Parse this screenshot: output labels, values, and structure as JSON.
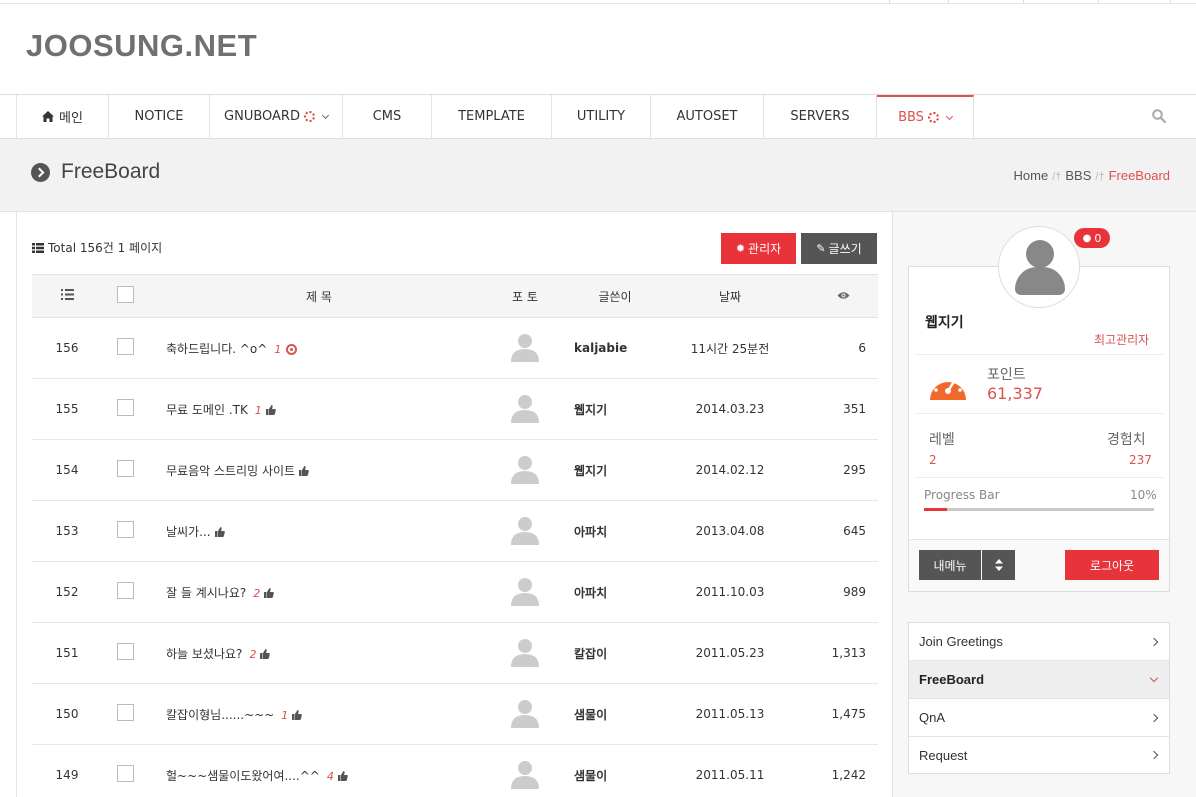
{
  "site": {
    "logo": "JOOSUNG.NET"
  },
  "nav": {
    "items": [
      {
        "label": "메인",
        "icon": "home-icon"
      },
      {
        "label": "NOTICE"
      },
      {
        "label": "GNUBOARD",
        "spinner": true,
        "dropdown": true
      },
      {
        "label": "CMS"
      },
      {
        "label": "TEMPLATE"
      },
      {
        "label": "UTILITY"
      },
      {
        "label": "AUTOSET"
      },
      {
        "label": "SERVERS"
      },
      {
        "label": "BBS",
        "spinner": true,
        "dropdown": true,
        "active": true
      }
    ],
    "search_icon": "search-icon"
  },
  "page": {
    "title": "FreeBoard",
    "breadcrumb": [
      "Home",
      "BBS",
      "FreeBoard"
    ]
  },
  "board": {
    "total_text": "Total 156건 1 페이지",
    "admin_label": "관리자",
    "write_label": "글쓰기",
    "headers": {
      "subject": "제 목",
      "photo": "포 토",
      "writer": "글쓴이",
      "date": "날짜"
    },
    "rows": [
      {
        "num": "156",
        "subject": "축하드립니다. ^o^",
        "comments": "1",
        "badge": "hot",
        "writer": "kaljabie",
        "date": "11시간 25분전",
        "views": "6"
      },
      {
        "num": "155",
        "subject": "무료 도메인 .TK",
        "comments": "1",
        "badge": "thumb",
        "writer": "웹지기",
        "date": "2014.03.23",
        "views": "351"
      },
      {
        "num": "154",
        "subject": "무료음악 스트리밍 사이트",
        "comments": "",
        "badge": "thumb",
        "writer": "웹지기",
        "date": "2014.02.12",
        "views": "295"
      },
      {
        "num": "153",
        "subject": "날씨가...",
        "comments": "",
        "badge": "thumb",
        "writer": "아파치",
        "date": "2013.04.08",
        "views": "645"
      },
      {
        "num": "152",
        "subject": "잘 들 계시나요?",
        "comments": "2",
        "badge": "thumb",
        "writer": "아파치",
        "date": "2011.10.03",
        "views": "989"
      },
      {
        "num": "151",
        "subject": "하늘 보셨나요?",
        "comments": "2",
        "badge": "thumb",
        "writer": "칼잡이",
        "date": "2011.05.23",
        "views": "1,313"
      },
      {
        "num": "150",
        "subject": "칼잡이형님......~~~",
        "comments": "1",
        "badge": "thumb",
        "writer": "샘물이",
        "date": "2011.05.13",
        "views": "1,475"
      },
      {
        "num": "149",
        "subject": "헐~~~샘물이도왔어여....^^",
        "comments": "4",
        "badge": "thumb",
        "writer": "샘물이",
        "date": "2011.05.11",
        "views": "1,242"
      }
    ]
  },
  "profile": {
    "messages": "0",
    "name": "웹지기",
    "role": "최고관리자",
    "point_label": "포인트",
    "point_value": "61,337",
    "level_label": "레벨",
    "level_value": "2",
    "exp_label": "경험치",
    "exp_value": "237",
    "progress_label": "Progress Bar",
    "progress_text": "10%",
    "progress_fraction": 0.1,
    "menu_label": "내메뉴",
    "logout_label": "로그아웃"
  },
  "side_menu": [
    {
      "label": "Join Greetings",
      "active": false
    },
    {
      "label": "FreeBoard",
      "active": true
    },
    {
      "label": "QnA",
      "active": false
    },
    {
      "label": "Request",
      "active": false
    }
  ],
  "colors": {
    "accent": "#e8333b",
    "link_red": "#d9534f",
    "dark_button": "#555555"
  }
}
